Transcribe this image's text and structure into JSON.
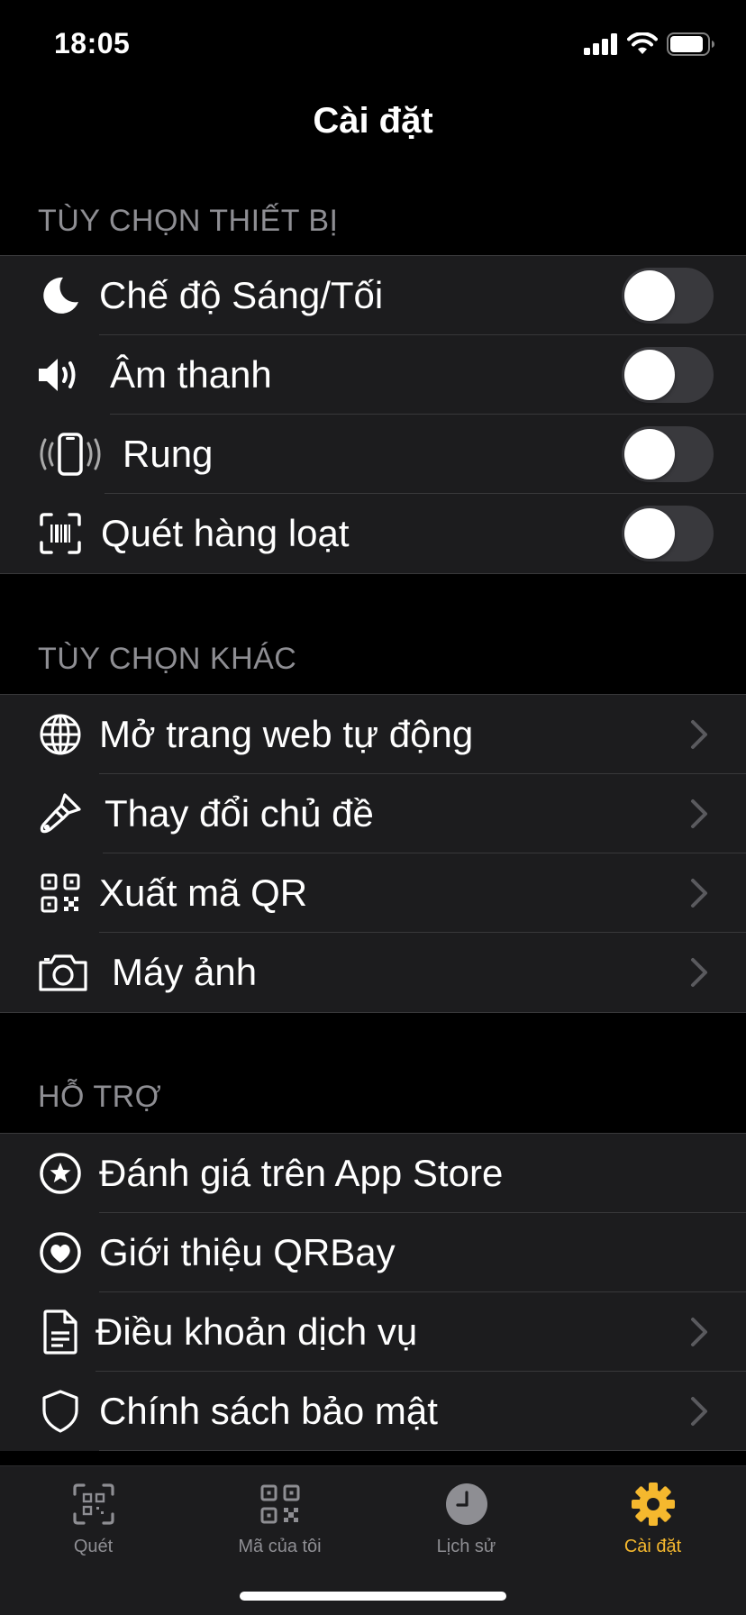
{
  "status_bar": {
    "time": "18:05"
  },
  "nav": {
    "title": "Cài đặt"
  },
  "sections": {
    "device": {
      "header": "TÙY CHỌN THIẾT BỊ",
      "items": [
        {
          "label": "Chế độ Sáng/Tối",
          "icon": "moon-icon",
          "toggle": false
        },
        {
          "label": "Âm thanh",
          "icon": "speaker-icon",
          "toggle": false
        },
        {
          "label": "Rung",
          "icon": "vibrate-phone-icon",
          "toggle": false
        },
        {
          "label": "Quét hàng loạt",
          "icon": "barcode-scan-icon",
          "toggle": false
        }
      ]
    },
    "other": {
      "header": "TÙY CHỌN KHÁC",
      "items": [
        {
          "label": "Mở trang web tự động",
          "icon": "globe-icon"
        },
        {
          "label": "Thay đổi chủ đề",
          "icon": "paintbrush-icon"
        },
        {
          "label": "Xuất mã QR",
          "icon": "qr-code-icon"
        },
        {
          "label": "Máy ảnh",
          "icon": "camera-icon"
        }
      ]
    },
    "support": {
      "header": "HỖ TRỢ",
      "items": [
        {
          "label": "Đánh giá trên App Store",
          "icon": "star-circle-icon"
        },
        {
          "label": "Giới thiệu QRBay",
          "icon": "heart-circle-icon"
        },
        {
          "label": "Điều khoản dịch vụ",
          "icon": "document-icon"
        },
        {
          "label": "Chính sách bảo mật",
          "icon": "shield-icon"
        }
      ]
    }
  },
  "tab_bar": {
    "tabs": [
      {
        "label": "Quét",
        "icon": "scan-icon"
      },
      {
        "label": "Mã của tôi",
        "icon": "qr-code-icon"
      },
      {
        "label": "Lịch sử",
        "icon": "clock-icon"
      },
      {
        "label": "Cài đặt",
        "icon": "gear-icon",
        "active": true
      }
    ]
  },
  "colors": {
    "accent": "#f5b82e",
    "background": "#000000",
    "cell": "#1c1c1e",
    "secondary_text": "#8e8e93"
  }
}
